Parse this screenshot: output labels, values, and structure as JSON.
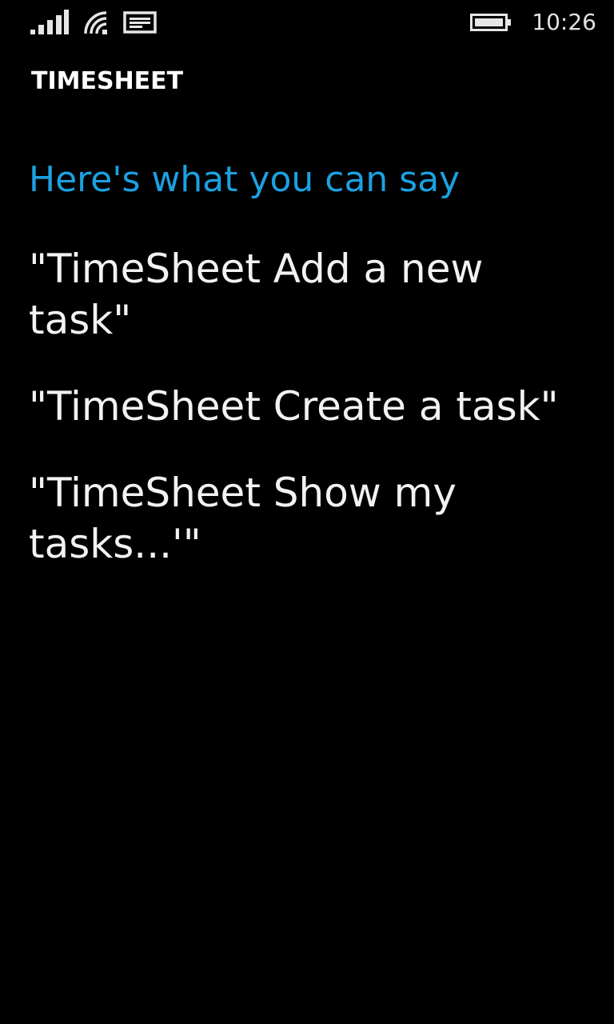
{
  "status_bar": {
    "time": "10:26",
    "icons": [
      "signal-strength-icon",
      "wifi-icon",
      "message-icon",
      "battery-icon"
    ]
  },
  "app": {
    "title": "TIMESHEET"
  },
  "main": {
    "heading": "Here's what you can say",
    "phrases": [
      "\"TimeSheet Add a new task\"",
      "\"TimeSheet Create a task\"",
      "\"TimeSheet Show my tasks...'\""
    ]
  },
  "colors": {
    "background": "#000000",
    "accent": "#1ba1e2",
    "text": "#ffffff"
  }
}
